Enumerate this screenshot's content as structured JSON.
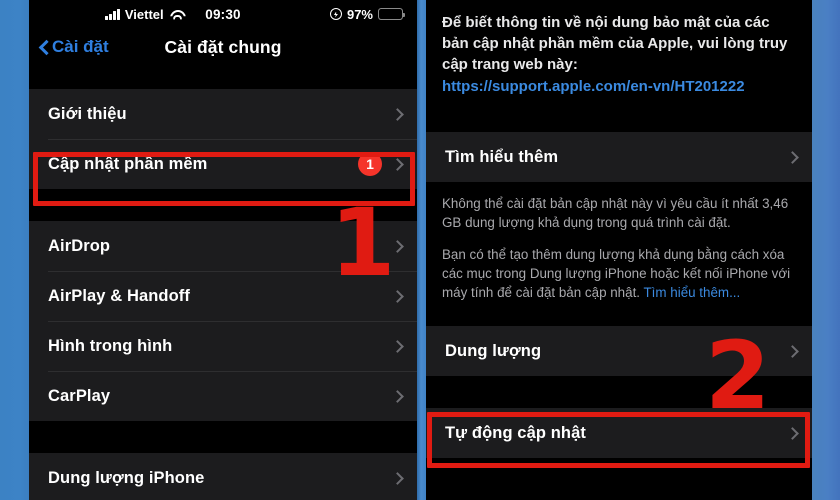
{
  "status_bar": {
    "carrier": "Viettel",
    "time": "09:30",
    "battery_percent": "97%",
    "signal_icon": "cellular-signal-icon",
    "wifi_icon": "wifi-icon",
    "low_power_icon": "low-power-mode-icon",
    "battery_icon": "battery-icon"
  },
  "left_phone": {
    "nav": {
      "back_label": "Cài đặt",
      "title": "Cài đặt chung",
      "back_icon": "chevron-left-icon"
    },
    "group_one": [
      {
        "label": "Giới thiệu",
        "badge": ""
      },
      {
        "label": "Cập nhật phần mềm",
        "badge": "1"
      }
    ],
    "group_two": [
      {
        "label": "AirDrop"
      },
      {
        "label": "AirPlay & Handoff"
      },
      {
        "label": "Hình trong hình"
      },
      {
        "label": "CarPlay"
      }
    ],
    "group_three": [
      {
        "label": "Dung lượng iPhone"
      }
    ]
  },
  "right_phone": {
    "blurb": {
      "text": "Để biết thông tin về nội dung bảo mật của các bản cập nhật phần mềm của Apple, vui lòng truy cập trang web này:",
      "link": "https://support.apple.com/en-vn/HT201222"
    },
    "learn_more_row": {
      "label": "Tìm hiểu thêm"
    },
    "note": {
      "paragraph_one": "Không thể cài đặt bản cập nhật này vì yêu cầu ít nhất 3,46 GB dung lượng khả dụng trong quá trình cài đặt.",
      "paragraph_two": "Bạn có thể tạo thêm dung lượng khả dụng bằng cách xóa các mục trong Dung lượng iPhone hoặc kết nối iPhone với máy tính để cài đặt bản cập nhật. ",
      "paragraph_two_link": "Tìm hiểu thêm..."
    },
    "storage_row": {
      "label": "Dung lượng"
    },
    "auto_update_row": {
      "label": "Tự động cập nhật"
    }
  },
  "annotations": {
    "step_one": "1",
    "step_two": "2",
    "highlight_color": "#e01b12",
    "badge_color": "#f5342a",
    "link_color": "#3b8ae0"
  }
}
